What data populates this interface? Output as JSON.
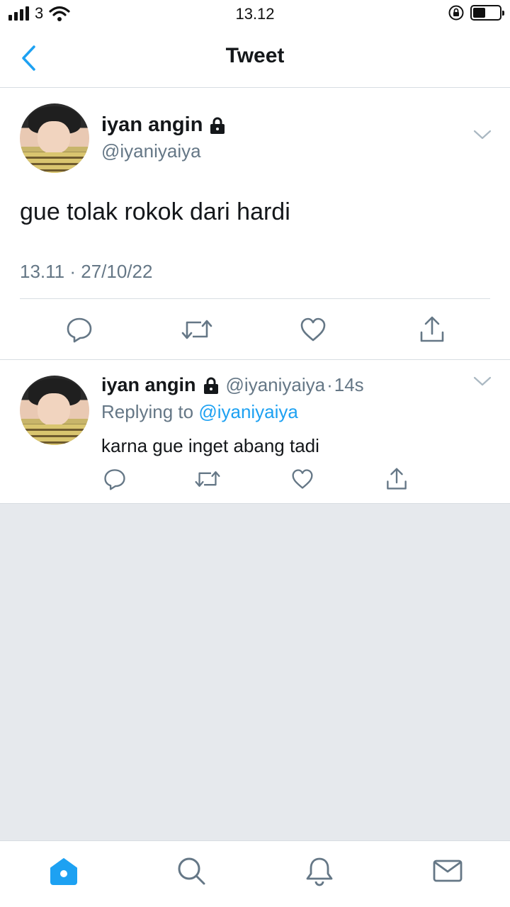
{
  "status_bar": {
    "carrier": "3",
    "time": "13.12",
    "battery_level": 0.46
  },
  "nav": {
    "title": "Tweet",
    "back_icon": "chevron-left-icon"
  },
  "main_tweet": {
    "display_name": "iyan angin",
    "handle": "@iyaniyaiya",
    "protected_icon": "lock-icon",
    "text": "gue tolak rokok dari hardi",
    "meta": "13.11 · 27/10/22"
  },
  "reply": {
    "display_name": "iyan angin",
    "handle": "@iyaniyaiya",
    "dot": "·",
    "time": "14s",
    "replying_prefix": "Replying to ",
    "replying_handle": "@iyaniyaiya",
    "text": "karna gue inget abang tadi"
  },
  "actions": [
    "reply-icon",
    "retweet-icon",
    "like-icon",
    "share-icon"
  ],
  "tabs": [
    "home-icon",
    "search-icon",
    "notifications-icon",
    "messages-icon"
  ],
  "colors": {
    "accent": "#1da1f2",
    "secondary_text": "#657786",
    "icon_gray": "#657786",
    "background_gray": "#e6e9ed",
    "divider": "#d8dde2"
  }
}
